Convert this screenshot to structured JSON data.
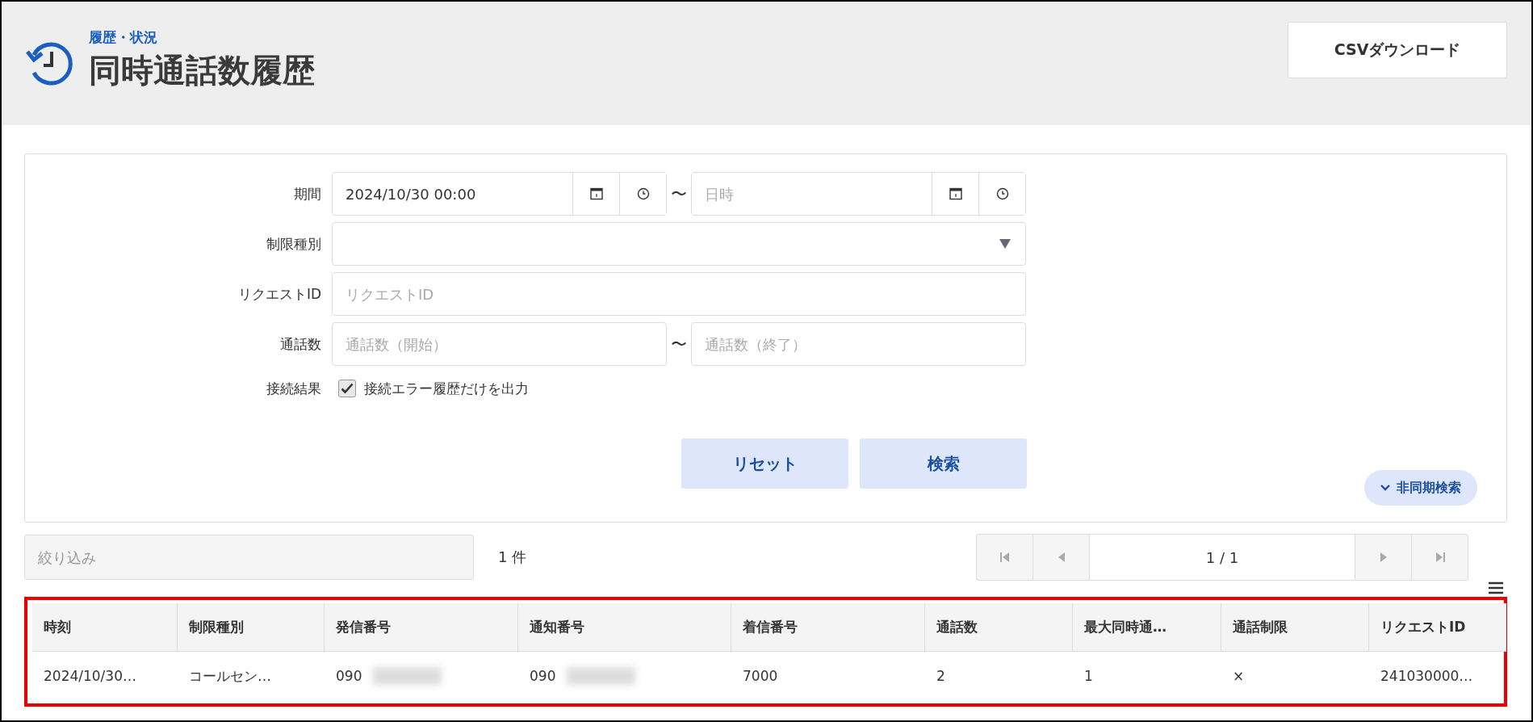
{
  "header": {
    "breadcrumb": "履歴・状況",
    "title": "同時通話数履歴",
    "csv_button": "CSVダウンロード"
  },
  "search_form": {
    "period": {
      "label": "期間",
      "start_value": "2024/10/30 00:00",
      "separator": "〜",
      "end_placeholder": "日時"
    },
    "limit_type": {
      "label": "制限種別"
    },
    "request_id": {
      "label": "リクエストID",
      "placeholder": "リクエストID"
    },
    "call_count": {
      "label": "通話数",
      "start_placeholder": "通話数（開始）",
      "separator": "〜",
      "end_placeholder": "通話数（終了）"
    },
    "connection_result": {
      "label": "接続結果",
      "checkbox_label": "接続エラー履歴だけを出力",
      "checked": true
    },
    "buttons": [
      "リセット",
      "検索"
    ],
    "async_search": {
      "label": "非同期検索",
      "expanded": false
    }
  },
  "filter": {
    "placeholder": "絞り込み"
  },
  "count": "1 件",
  "pagination": {
    "page": "1 / 1"
  },
  "table": {
    "highlighted": true,
    "columns": [
      "時刻",
      "制限種別",
      "発信番号",
      "通知番号",
      "着信番号",
      "通話数",
      "最大同時通…",
      "通話制限",
      "リクエストID"
    ],
    "rows": [
      {
        "cells": [
          {
            "text": "2024/10/30…"
          },
          {
            "text": "コールセン…"
          },
          {
            "text": "090",
            "redacted": true
          },
          {
            "text": "090",
            "redacted": true
          },
          {
            "text": "7000"
          },
          {
            "text": "2"
          },
          {
            "text": "1"
          },
          {
            "text": "×"
          },
          {
            "text": "241030000…"
          }
        ]
      }
    ]
  }
}
